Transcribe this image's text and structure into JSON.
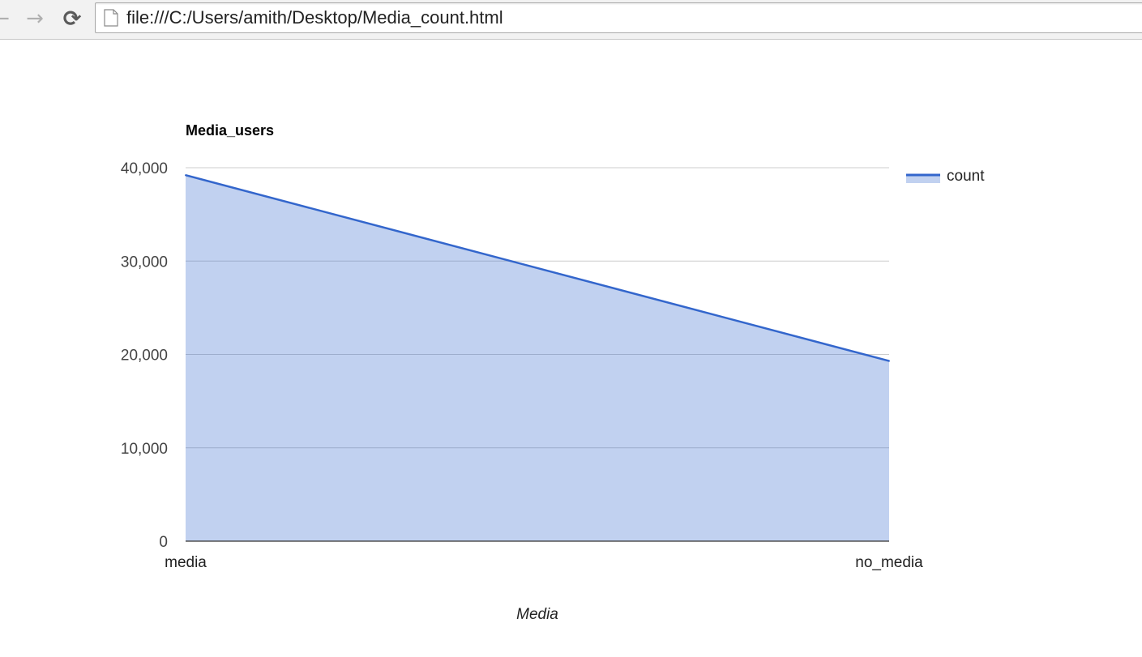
{
  "browser": {
    "url": "file:///C:/Users/amith/Desktop/Media_count.html",
    "back_icon": "arrow-left-icon",
    "forward_icon": "arrow-right-icon",
    "reload_icon": "reload-icon",
    "page_icon": "document-icon"
  },
  "chart_data": {
    "type": "area",
    "title": "Media_users",
    "xlabel": "Media",
    "ylabel": "",
    "categories": [
      "media",
      "no_media"
    ],
    "series": [
      {
        "name": "count",
        "values": [
          39200,
          19300
        ],
        "color": "#3366cc"
      }
    ],
    "ylim": [
      0,
      40000
    ],
    "yticks": [
      0,
      10000,
      20000,
      30000,
      40000
    ],
    "ytick_labels": [
      "0",
      "10,000",
      "20,000",
      "30,000",
      "40,000"
    ],
    "grid": true,
    "legend_position": "right",
    "fill_color": "#c2d1f0"
  }
}
